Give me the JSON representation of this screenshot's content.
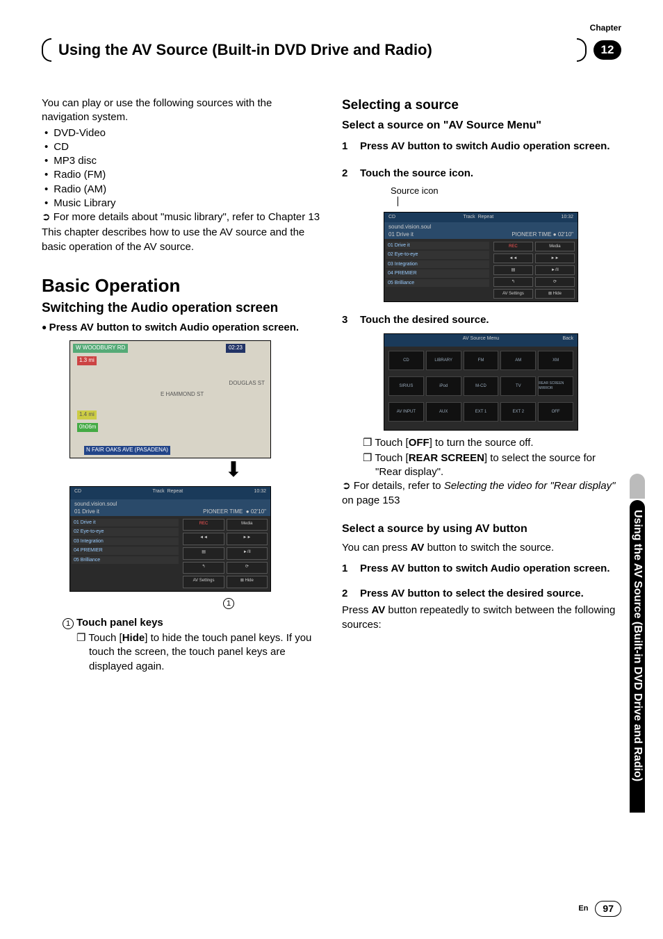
{
  "chapter_label": "Chapter",
  "chapter_number": "12",
  "page_title": "Using the AV Source (Built-in DVD Drive and Radio)",
  "left": {
    "intro": "You can play or use the following sources with the navigation system.",
    "sources": [
      "DVD-Video",
      "CD",
      "MP3 disc",
      "Radio (FM)",
      "Radio (AM)",
      "Music Library"
    ],
    "pointer_more": "For more details about \"music library\", refer to Chapter 13",
    "desc": "This chapter describes how to use the AV source and the basic operation of the AV source.",
    "h1": "Basic Operation",
    "h2": "Switching the Audio operation screen",
    "bullet_step": "Press AV button to switch Audio operation screen.",
    "map": {
      "road_top": "W WOODBURY RD",
      "dist1": "1.3 mi",
      "time": "02:23",
      "road_r": "DOUGLAS ST",
      "road_mid": "E HAMMOND ST",
      "dist2": "1.4 mi",
      "eta": "0h06m",
      "road_bottom": "N FAIR OAKS AVE (PASADENA)"
    },
    "shot": {
      "top_l": "CD",
      "top_track": "Track",
      "top_repeat": "Repeat",
      "top_time": "10:32",
      "sub1": "sound.vision.soul",
      "sub2": "01 Drive it",
      "sub_right": "PIONEER TIME",
      "sub_dur": "02'10\"",
      "list": [
        "01 Drive it",
        "02 Eye-to-eye",
        "03 Integration",
        "04 PREMIER",
        "05 Brilliance"
      ],
      "btns": [
        "REC",
        "Media",
        "◄◄",
        "►►",
        "▤",
        "►/II",
        "↰",
        "⟳",
        "AV Settings",
        "⊠ Hide"
      ]
    },
    "callout1_num": "1",
    "callout1_label": "Touch panel keys",
    "callout1_body_a": "Touch [",
    "callout1_body_b": "Hide",
    "callout1_body_c": "] to hide the touch panel keys. If you touch the screen, the touch panel keys are displayed again."
  },
  "right": {
    "h2": "Selecting a source",
    "h3a": "Select a source on \"AV Source Menu\"",
    "step1_num": "1",
    "step1": "Press AV button to switch Audio operation screen.",
    "step2_num": "2",
    "step2": "Touch the source icon.",
    "src_caption": "Source icon",
    "step3_num": "3",
    "step3": "Touch the desired source.",
    "menu": {
      "title": "AV Source Menu",
      "back": "Back",
      "cells": [
        "CD",
        "LIBRARY",
        "FM",
        "AM",
        "XM",
        "SIRIUS",
        "iPod",
        "M-CD",
        "TV",
        "REAR SCREEN MIRROR",
        "AV INPUT",
        "AUX",
        "EXT 1",
        "EXT 2",
        "OFF"
      ]
    },
    "chk1_a": "Touch [",
    "chk1_b": "OFF",
    "chk1_c": "] to turn the source off.",
    "chk2_a": "Touch [",
    "chk2_b": "REAR SCREEN",
    "chk2_c": "] to select the source for \"Rear display\".",
    "pointer2_a": "For details, refer to ",
    "pointer2_b": "Selecting the video for \"Rear display\"",
    "pointer2_c": " on page 153",
    "h3b": "Select a source by using AV button",
    "p_avpress_a": "You can press ",
    "p_avpress_b": "AV",
    "p_avpress_c": " button to switch the source.",
    "stepB1_num": "1",
    "stepB1": "Press AV button to switch Audio operation screen.",
    "stepB2_num": "2",
    "stepB2": "Press AV button to select the desired source.",
    "final_a": "Press ",
    "final_b": "AV",
    "final_c": " button repeatedly to switch between the following sources:"
  },
  "sidetab": "Using the AV Source (Built-in DVD Drive and Radio)",
  "footer_en": "En",
  "footer_page": "97"
}
